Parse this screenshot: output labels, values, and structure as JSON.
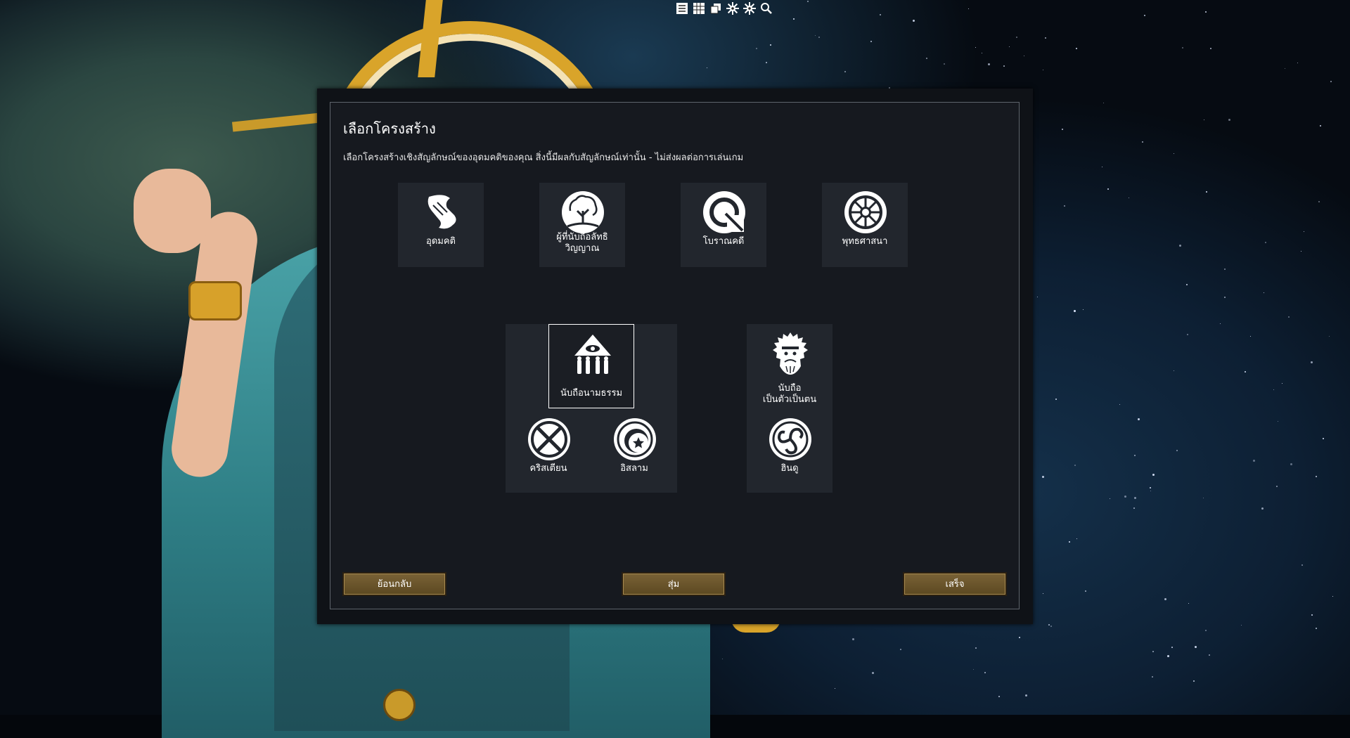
{
  "toolbar": {
    "icons": [
      "list-icon",
      "table-icon",
      "layers-icon",
      "settings-icon",
      "settings-alt-icon",
      "search-icon"
    ]
  },
  "dialog": {
    "title": "เลือกโครงสร้าง",
    "description": "เลือกโครงสร้างเชิงสัญลักษณ์ของอุดมคติของคุณ สิ่งนี้มีผลกับสัญลักษณ์เท่านั้น - ไม่ส่งผลต่อการเล่นเกม",
    "top_options": [
      {
        "label": "อุดมคติ",
        "icon": "scroll-icon"
      },
      {
        "label": "ผู้ที่นับถือลัทธิ",
        "label2": "วิญญาณ",
        "icon": "tree-icon"
      },
      {
        "label": "โบราณคดี",
        "icon": "ring-icon"
      },
      {
        "label": "พุทธศาสนา",
        "icon": "dharma-wheel-icon"
      }
    ],
    "monotheism": {
      "label": "นับถือนามธรรม",
      "icon": "eye-pyramid-icon",
      "selected": true
    },
    "polytheism": {
      "label": "นับถือ",
      "label2": "เป็นตัวเป็นตน",
      "icon": "bearded-god-icon"
    },
    "sub_options": [
      {
        "label": "คริสเตียน",
        "icon": "cross-circle-icon"
      },
      {
        "label": "อิสลาม",
        "icon": "crescent-star-icon"
      },
      {
        "label": "ฮินดู",
        "icon": "om-spiral-icon"
      }
    ],
    "buttons": {
      "back": "ย้อนกลับ",
      "random": "สุ่ม",
      "done": "เสร็จ"
    }
  },
  "colors": {
    "button_gold": "#6b5530",
    "panel": "#16191f",
    "card": "#22262d"
  }
}
